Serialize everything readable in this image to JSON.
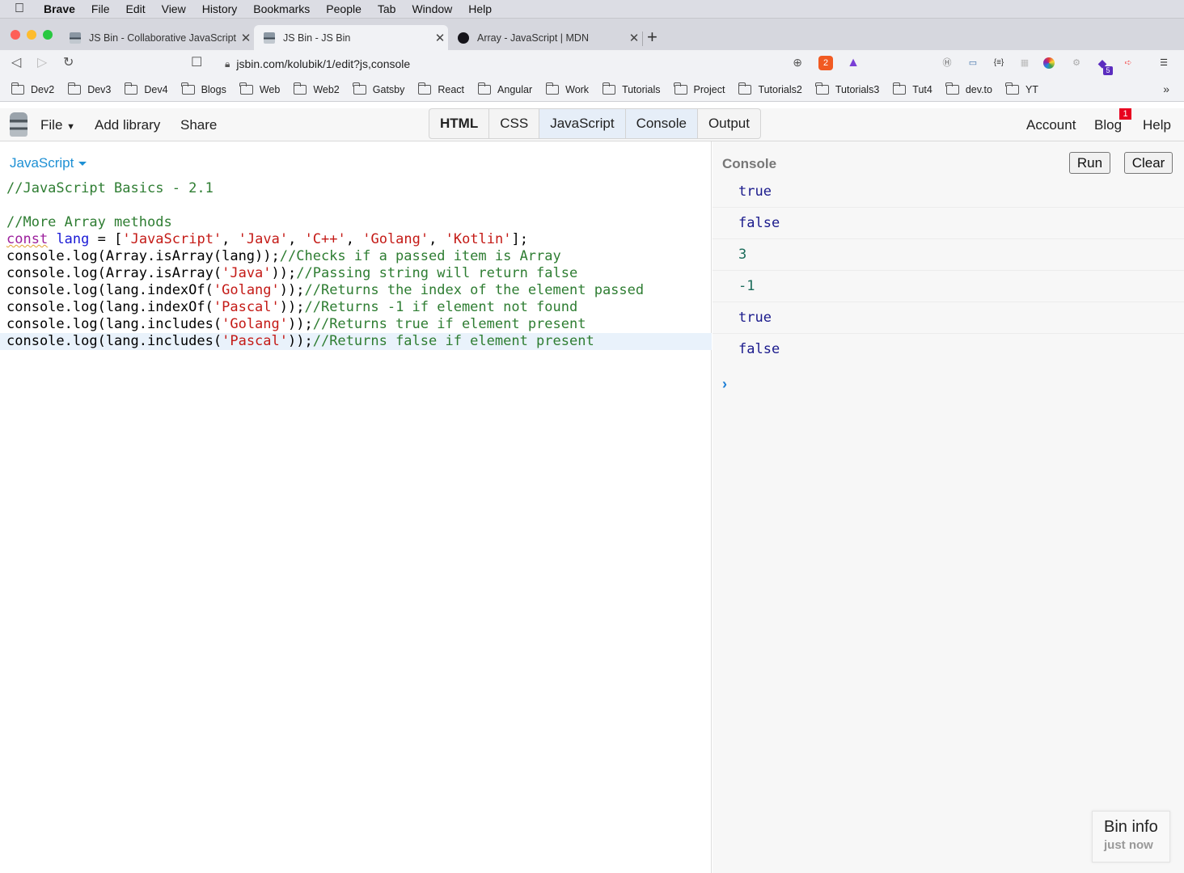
{
  "menubar": {
    "app": "Brave",
    "items": [
      "File",
      "Edit",
      "View",
      "History",
      "Bookmarks",
      "People",
      "Tab",
      "Window",
      "Help"
    ]
  },
  "tabs": [
    {
      "title": "JS Bin - Collaborative JavaScript Debugging",
      "active": false
    },
    {
      "title": "JS Bin - JS Bin",
      "active": true
    },
    {
      "title": "Array - JavaScript | MDN",
      "active": false
    }
  ],
  "address": {
    "url": "jsbin.com/kolubik/1/edit?js,console"
  },
  "extensions": {
    "brave_shield_count": "2",
    "ext_badge_count": "5"
  },
  "bookmarks": [
    "Dev2",
    "Dev3",
    "Dev4",
    "Blogs",
    "Web",
    "Web2",
    "Gatsby",
    "React",
    "Angular",
    "Work",
    "Tutorials",
    "Project",
    "Tutorials2",
    "Tutorials3",
    "Tut4",
    "dev.to",
    "YT"
  ],
  "jsbin": {
    "file": "File",
    "add_library": "Add library",
    "share": "Share",
    "panels": [
      {
        "label": "HTML",
        "on": false,
        "bold": true
      },
      {
        "label": "CSS",
        "on": false,
        "bold": false
      },
      {
        "label": "JavaScript",
        "on": true,
        "bold": false
      },
      {
        "label": "Console",
        "on": true,
        "bold": false
      },
      {
        "label": "Output",
        "on": false,
        "bold": false
      }
    ],
    "account": "Account",
    "blog": "Blog",
    "blog_badge": "1",
    "help": "Help"
  },
  "editor": {
    "language": "JavaScript",
    "lines": [
      [
        {
          "t": "//JavaScript Basics - 2.1",
          "k": "com"
        }
      ],
      [],
      [
        {
          "t": "//More Array methods",
          "k": "com"
        }
      ],
      [
        {
          "t": "const",
          "k": "kw"
        },
        {
          "t": " "
        },
        {
          "t": "lang",
          "k": "def"
        },
        {
          "t": " = ["
        },
        {
          "t": "'JavaScript'",
          "k": "str"
        },
        {
          "t": ", "
        },
        {
          "t": "'Java'",
          "k": "str"
        },
        {
          "t": ", "
        },
        {
          "t": "'C++'",
          "k": "str"
        },
        {
          "t": ", "
        },
        {
          "t": "'Golang'",
          "k": "str"
        },
        {
          "t": ", "
        },
        {
          "t": "'Kotlin'",
          "k": "str"
        },
        {
          "t": "];"
        }
      ],
      [
        {
          "t": "console.log(Array.isArray(lang));"
        },
        {
          "t": "//Checks if a passed item is Array",
          "k": "com"
        }
      ],
      [
        {
          "t": "console.log(Array.isArray("
        },
        {
          "t": "'Java'",
          "k": "str"
        },
        {
          "t": "));"
        },
        {
          "t": "//Passing string will return false",
          "k": "com"
        }
      ],
      [
        {
          "t": "console.log(lang.indexOf("
        },
        {
          "t": "'Golang'",
          "k": "str"
        },
        {
          "t": "));"
        },
        {
          "t": "//Returns the index of the element passed",
          "k": "com"
        }
      ],
      [
        {
          "t": "console.log(lang.indexOf("
        },
        {
          "t": "'Pascal'",
          "k": "str"
        },
        {
          "t": "));"
        },
        {
          "t": "//Returns -1 if element not found",
          "k": "com"
        }
      ],
      [
        {
          "t": "console.log(lang.includes("
        },
        {
          "t": "'Golang'",
          "k": "str"
        },
        {
          "t": "));"
        },
        {
          "t": "//Returns true if element present",
          "k": "com"
        }
      ],
      [
        {
          "t": "console.log(lang.includes("
        },
        {
          "t": "'Pascal'",
          "k": "str"
        },
        {
          "t": "));"
        },
        {
          "t": "//Returns false if element present",
          "k": "com"
        }
      ]
    ],
    "highlighted_line": 9
  },
  "console": {
    "label": "Console",
    "run": "Run",
    "clear": "Clear",
    "output": [
      {
        "text": "true",
        "color": "#1a1a8c"
      },
      {
        "text": "false",
        "color": "#1a1a8c"
      },
      {
        "text": "3",
        "color": "#1a6b5a"
      },
      {
        "text": "-1",
        "color": "#1a6b5a"
      },
      {
        "text": "true",
        "color": "#1a1a8c"
      },
      {
        "text": "false",
        "color": "#1a1a8c"
      }
    ],
    "prompt": "›"
  },
  "bin_info": {
    "title": "Bin info",
    "time": "just now"
  }
}
